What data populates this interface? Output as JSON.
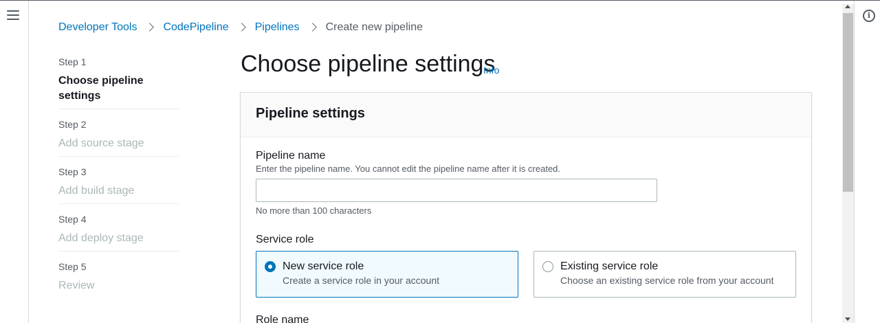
{
  "breadcrumb": {
    "items": [
      "Developer Tools",
      "CodePipeline",
      "Pipelines"
    ],
    "current": "Create new pipeline"
  },
  "steps": [
    {
      "num": "Step 1",
      "title": "Choose pipeline settings"
    },
    {
      "num": "Step 2",
      "title": "Add source stage"
    },
    {
      "num": "Step 3",
      "title": "Add build stage"
    },
    {
      "num": "Step 4",
      "title": "Add deploy stage"
    },
    {
      "num": "Step 5",
      "title": "Review"
    }
  ],
  "page": {
    "title": "Choose pipeline settings",
    "info": "Info"
  },
  "panel": {
    "title": "Pipeline settings",
    "pipeline_name": {
      "label": "Pipeline name",
      "description": "Enter the pipeline name. You cannot edit the pipeline name after it is created.",
      "value": "",
      "constraint": "No more than 100 characters"
    },
    "service_role": {
      "label": "Service role",
      "options": [
        {
          "title": "New service role",
          "description": "Create a service role in your account",
          "selected": true
        },
        {
          "title": "Existing service role",
          "description": "Choose an existing service role from your account",
          "selected": false
        }
      ]
    },
    "role_name_label": "Role name"
  },
  "colors": {
    "link": "#0073bb",
    "selected_bg": "#f1faff",
    "text": "#16191f",
    "muted": "#aab7b8"
  },
  "icons": {
    "menu": "hamburger-icon",
    "info": "info-circle-icon",
    "separator": "chevron-right-icon"
  }
}
